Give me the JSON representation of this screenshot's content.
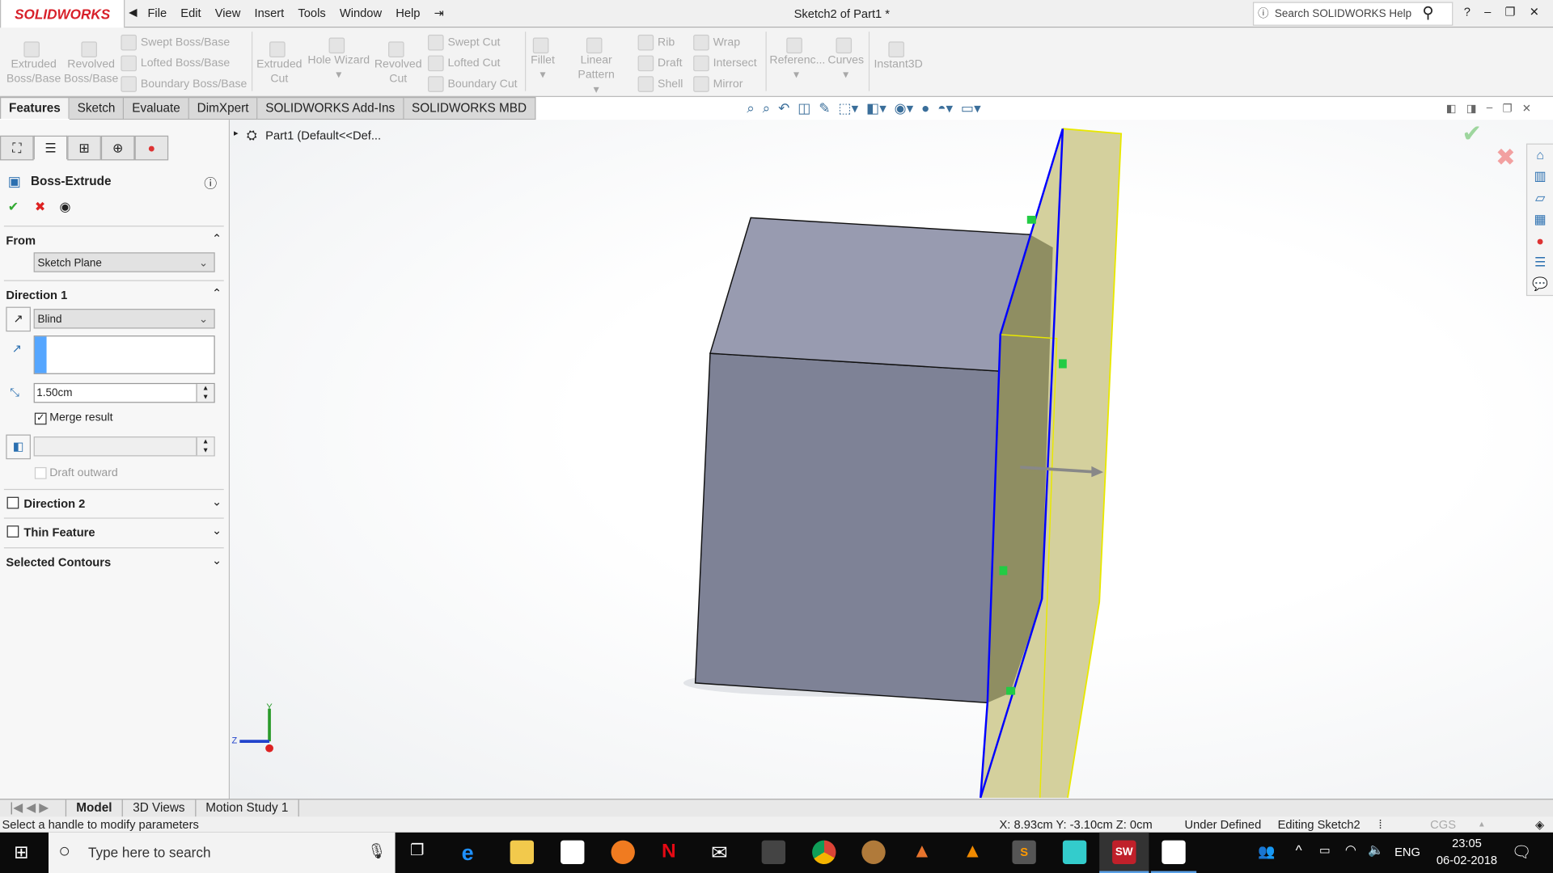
{
  "app": {
    "logo": "SOLIDWORKS",
    "title": "Sketch2 of Part1 *",
    "help_search_placeholder": "Search SOLIDWORKS Help"
  },
  "menu": [
    "File",
    "Edit",
    "View",
    "Insert",
    "Tools",
    "Window",
    "Help"
  ],
  "toolbar": {
    "extruded_boss": "Extruded Boss/Base",
    "revolved_boss": "Revolved Boss/Base",
    "swept_boss": "Swept Boss/Base",
    "lofted_boss": "Lofted Boss/Base",
    "boundary_boss": "Boundary Boss/Base",
    "extruded_cut": "Extruded Cut",
    "hole_wizard": "Hole Wizard",
    "revolved_cut": "Revolved Cut",
    "swept_cut": "Swept Cut",
    "lofted_cut": "Lofted Cut",
    "boundary_cut": "Boundary Cut",
    "fillet": "Fillet",
    "linear_pattern": "Linear Pattern",
    "rib": "Rib",
    "draft": "Draft",
    "shell": "Shell",
    "wrap": "Wrap",
    "intersect": "Intersect",
    "mirror": "Mirror",
    "reference": "Referenc...",
    "curves": "Curves",
    "instant3d": "Instant3D"
  },
  "tabs": [
    "Features",
    "Sketch",
    "Evaluate",
    "DimXpert",
    "SOLIDWORKS Add-Ins",
    "SOLIDWORKS MBD"
  ],
  "active_tab": "Features",
  "tree": {
    "root": "Part1  (Default<<Def..."
  },
  "property_manager": {
    "title": "Boss-Extrude",
    "from": {
      "label": "From",
      "value": "Sketch Plane"
    },
    "direction1": {
      "label": "Direction 1",
      "end_condition": "Blind",
      "depth": "1.50cm",
      "merge_label": "Merge result",
      "merge_checked": true,
      "draft_label": "Draft outward",
      "draft_checked": false
    },
    "direction2": {
      "label": "Direction 2",
      "checked": false
    },
    "thin_feature": {
      "label": "Thin Feature",
      "checked": false
    },
    "selected_contours": {
      "label": "Selected Contours"
    }
  },
  "triad": {
    "y": "Y",
    "z": "Z"
  },
  "bottom_tabs": [
    "Model",
    "3D Views",
    "Motion Study 1"
  ],
  "status": {
    "message": "Select a handle to modify parameters",
    "coords": "X: 8.93cm Y: -3.10cm Z: 0cm",
    "state": "Under Defined",
    "editing": "Editing Sketch2",
    "units": "CGS"
  },
  "taskbar": {
    "search_placeholder": "Type here to search",
    "lang": "ENG",
    "time": "23:05",
    "date": "06-02-2018"
  },
  "colors": {
    "sketch_line": "#0000ff",
    "preview": "#d8d49a",
    "part": "#8f93aa",
    "logo_red": "#d8202a"
  }
}
